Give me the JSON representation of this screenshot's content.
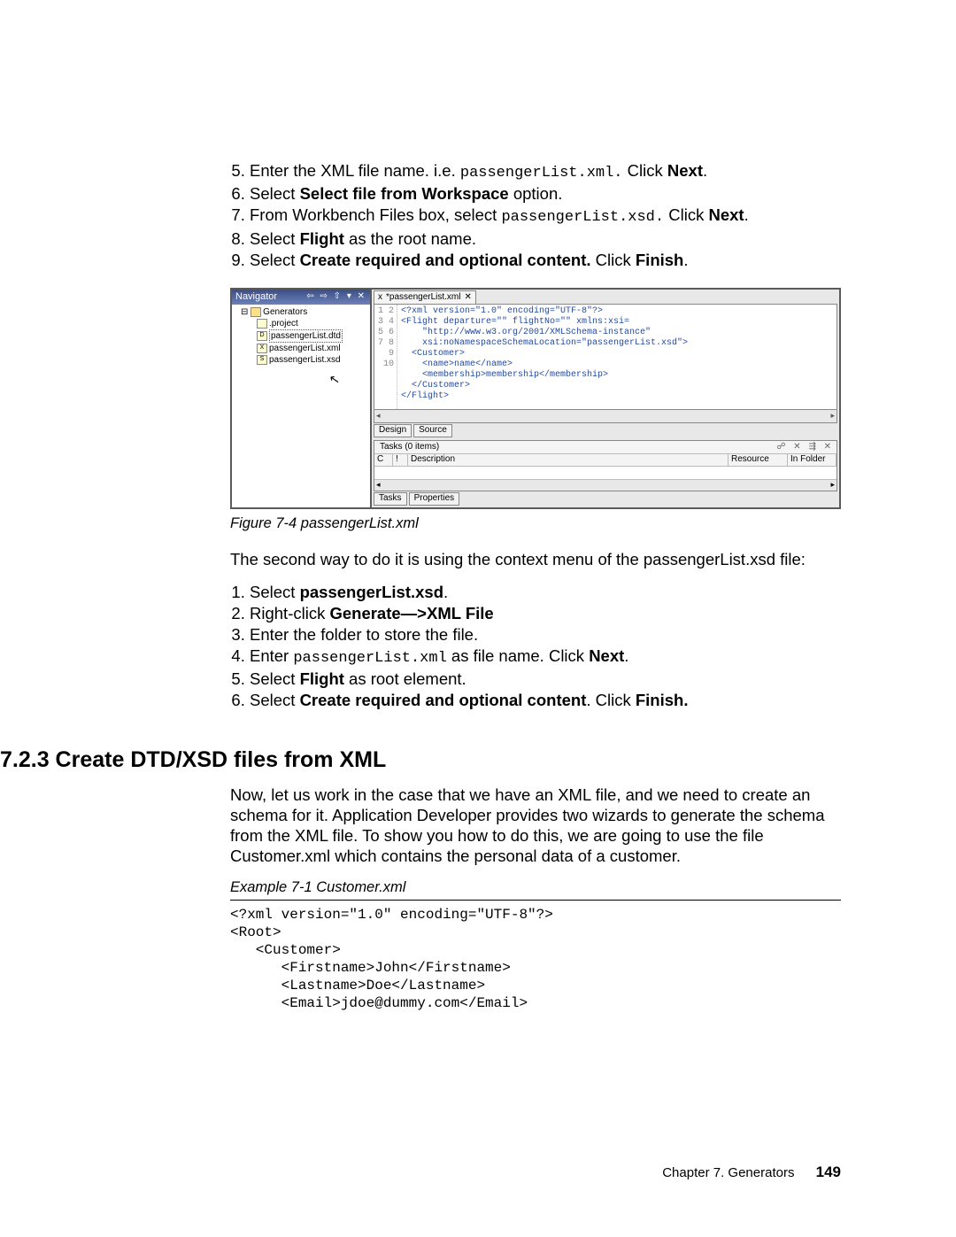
{
  "steps1": {
    "start": 5,
    "l5a": "Enter the XML file name. i.e. ",
    "l5code": "passengerList.xml.",
    "l5b": " Click ",
    "l5bold": "Next",
    "l5c": ".",
    "l6a": "Select ",
    "l6bold": "Select file from Workspace",
    "l6b": " option.",
    "l7a": "From Workbench Files box, select ",
    "l7code": "passengerList.xsd.",
    "l7b": " Click ",
    "l7bold": "Next",
    "l7c": ".",
    "l8a": "Select ",
    "l8bold": "Flight",
    "l8b": " as the root name.",
    "l9a": "Select ",
    "l9bold": "Create required and optional content.",
    "l9b": " Click ",
    "l9bold2": "Finish",
    "l9c": "."
  },
  "ide": {
    "nav_title": "Navigator",
    "nav_tools": "⇦ ⇨ ⇧ ▾ ✕",
    "tree": {
      "root": "Generators",
      "items": [
        ".project",
        "passengerList.dtd",
        "passengerList.xml",
        "passengerList.xsd"
      ]
    },
    "tab": "*passengerList.xml",
    "gutter": "1\n2\n3\n4\n5\n6\n7\n8\n9\n10",
    "code": "<?xml version=\"1.0\" encoding=\"UTF-8\"?>\n<Flight departure=\"\" flightNo=\"\" xmlns:xsi=\n    \"http://www.w3.org/2001/XMLSchema-instance\"\n    xsi:noNamespaceSchemaLocation=\"passengerList.xsd\">\n  <Customer>\n    <name>name</name>\n    <membership>membership</membership>\n  </Customer>\n</Flight>",
    "bottom_tabs": [
      "Design",
      "Source"
    ],
    "tasks_title": "Tasks (0 items)",
    "tasks_tools": "☍ ✕ ⇶ ✕",
    "cols": {
      "c": "C",
      "b": "!",
      "d": "Description",
      "r": "Resource",
      "f": "In Folder"
    },
    "lower_tabs": [
      "Tasks",
      "Properties"
    ]
  },
  "fig_caption": "Figure 7-4   passengerList.xml",
  "para1": "The second way to do it is using the context menu of the passengerList.xsd file:",
  "steps2": {
    "l1a": "Select ",
    "l1b": "passengerList.xsd",
    "l1c": ".",
    "l2a": "Right-click ",
    "l2b": "Generate—>XML File",
    "l3": "Enter the folder to store the file.",
    "l4a": "Enter ",
    "l4code": "passengerList.xml",
    "l4b": " as file name. Click ",
    "l4bold": "Next",
    "l4c": ".",
    "l5a": "Select ",
    "l5b": "Flight",
    "l5c": " as root element.",
    "l6a": "Select ",
    "l6b": "Create required and optional content",
    "l6c": ". Click ",
    "l6d": "Finish."
  },
  "section_title": "7.2.3  Create DTD/XSD files from XML",
  "para2": "Now, let us work in the case that we have an XML file, and we need to create an schema for it. Application Developer provides two wizards to generate the schema from the XML file. To show you how to do this, we are going to use the file Customer.xml which contains the personal data of a customer.",
  "ex_caption": "Example 7-1   Customer.xml",
  "code_sample": "<?xml version=\"1.0\" encoding=\"UTF-8\"?>\n<Root>\n   <Customer>\n      <Firstname>John</Firstname>\n      <Lastname>Doe</Lastname>\n      <Email>jdoe@dummy.com</Email>",
  "footer_text": "Chapter 7. Generators",
  "footer_page": "149"
}
